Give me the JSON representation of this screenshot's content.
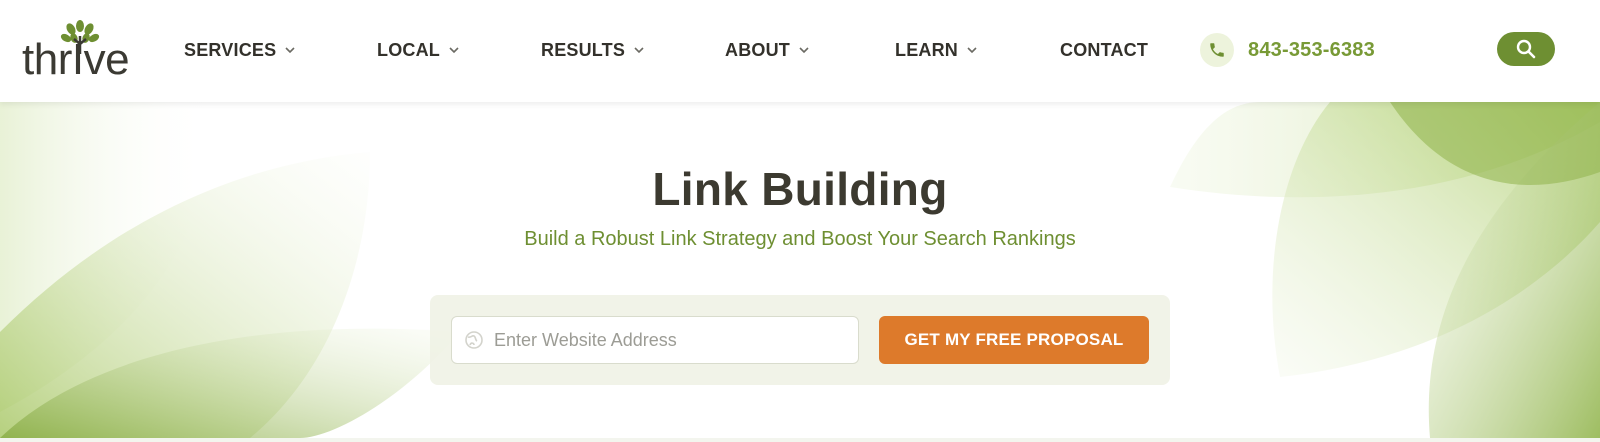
{
  "brand": {
    "logo_text": "thrIve",
    "accent": "#6e8f32",
    "cta_color": "#dd7a2b",
    "text_color": "#3c3a30"
  },
  "nav": {
    "items": [
      {
        "label": "SERVICES",
        "has_dropdown": true
      },
      {
        "label": "LOCAL",
        "has_dropdown": true
      },
      {
        "label": "RESULTS",
        "has_dropdown": true
      },
      {
        "label": "ABOUT",
        "has_dropdown": true
      },
      {
        "label": "LEARN",
        "has_dropdown": true
      },
      {
        "label": "CONTACT",
        "has_dropdown": false
      }
    ],
    "phone": {
      "icon": "phone-icon",
      "number": "843-353-6383"
    },
    "search": {
      "icon": "search-icon"
    }
  },
  "hero": {
    "title": "Link Building",
    "subtitle": "Build a Robust Link Strategy and Boost Your Search Rankings",
    "form": {
      "input_icon": "globe-icon",
      "input_value": "",
      "input_placeholder": "Enter Website Address",
      "cta_label": "GET MY FREE PROPOSAL"
    }
  }
}
